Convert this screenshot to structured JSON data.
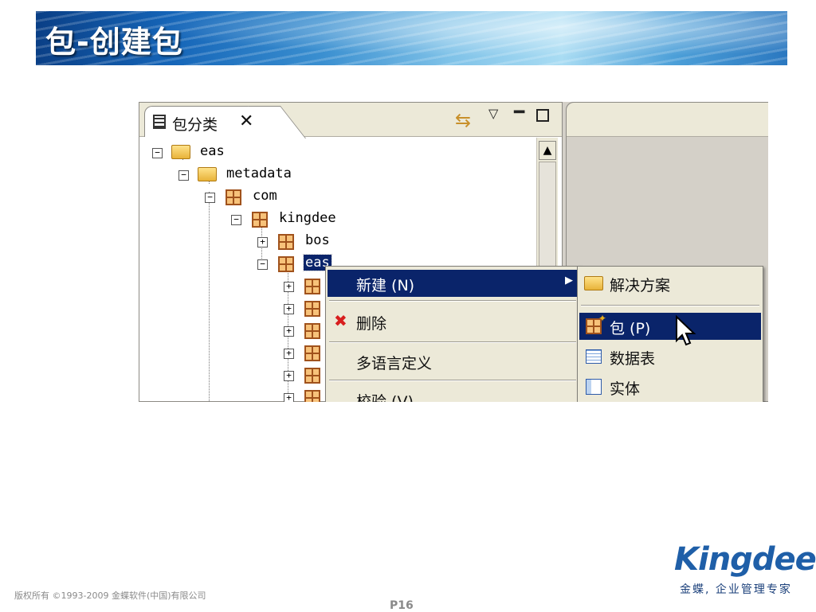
{
  "slide": {
    "title": "包-创建包",
    "copyright": "版权所有 ©1993-2009 金蝶软件(中国)有限公司",
    "page_number": "P16",
    "logo_text": "Kingdee",
    "tagline": "金蝶, 企业管理专家"
  },
  "panel": {
    "tab_label": "包分类",
    "tab_close": "✕",
    "sync_icon": "⇆",
    "menu_icon": "▽",
    "min_icon": "━"
  },
  "tree": {
    "nodes": [
      {
        "label": "eas",
        "toggle": "−"
      },
      {
        "label": "metadata",
        "toggle": "−"
      },
      {
        "label": "com",
        "toggle": "−"
      },
      {
        "label": "kingdee",
        "toggle": "−"
      },
      {
        "label": "bos",
        "toggle": "+"
      },
      {
        "label": "eas",
        "toggle": "−"
      },
      {
        "label": "",
        "toggle": "+"
      },
      {
        "label": "",
        "toggle": "+"
      },
      {
        "label": "",
        "toggle": "+"
      },
      {
        "label": "",
        "toggle": "+"
      },
      {
        "label": "",
        "toggle": "+"
      },
      {
        "label": "",
        "toggle": "+"
      }
    ]
  },
  "context_menu": {
    "items": [
      {
        "label": "新建 (N)",
        "submenu_arrow": "▶"
      },
      {
        "label": "删除",
        "icon": "✖"
      },
      {
        "label": "多语言定义"
      },
      {
        "label": "校验 (V)"
      }
    ]
  },
  "submenu": {
    "items": [
      {
        "label": "解决方案"
      },
      {
        "label": "包 (P)"
      },
      {
        "label": "数据表"
      },
      {
        "label": "实体"
      }
    ]
  },
  "colors": {
    "selection": "#0a246a",
    "menu_bg": "#ece9d8",
    "brand_blue": "#1f5fa8"
  }
}
